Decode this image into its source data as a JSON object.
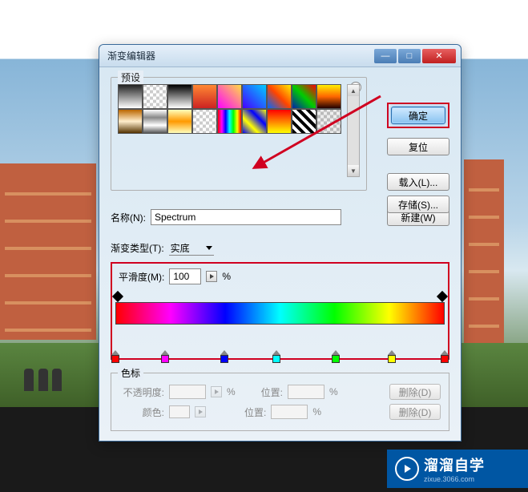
{
  "window": {
    "title": "渐变编辑器"
  },
  "buttons": {
    "ok": "确定",
    "reset": "复位",
    "load": "载入(L)...",
    "save": "存储(S)...",
    "new": "新建(W)",
    "delete": "删除(D)",
    "delete2": "删除(D)"
  },
  "labels": {
    "presets": "预设",
    "name": "名称(N):",
    "gradientType": "渐变类型(T):",
    "smoothness": "平滑度(M):",
    "stops": "色标",
    "opacity": "不透明度:",
    "position": "位置:",
    "position2": "位置:",
    "color": "颜色:",
    "percent": "%"
  },
  "values": {
    "name": "Spectrum",
    "gradientType": "实底",
    "smoothness": "100"
  },
  "colorStops": [
    {
      "pos": 0,
      "color": "#ff0000"
    },
    {
      "pos": 15,
      "color": "#ff00ff"
    },
    {
      "pos": 33,
      "color": "#0000ff"
    },
    {
      "pos": 49,
      "color": "#00ffff"
    },
    {
      "pos": 67,
      "color": "#00ff00"
    },
    {
      "pos": 84,
      "color": "#ffff00"
    },
    {
      "pos": 100,
      "color": "#ff0000"
    }
  ],
  "watermark": {
    "text": "溜溜自学",
    "sub": "zixue.3066.com"
  }
}
